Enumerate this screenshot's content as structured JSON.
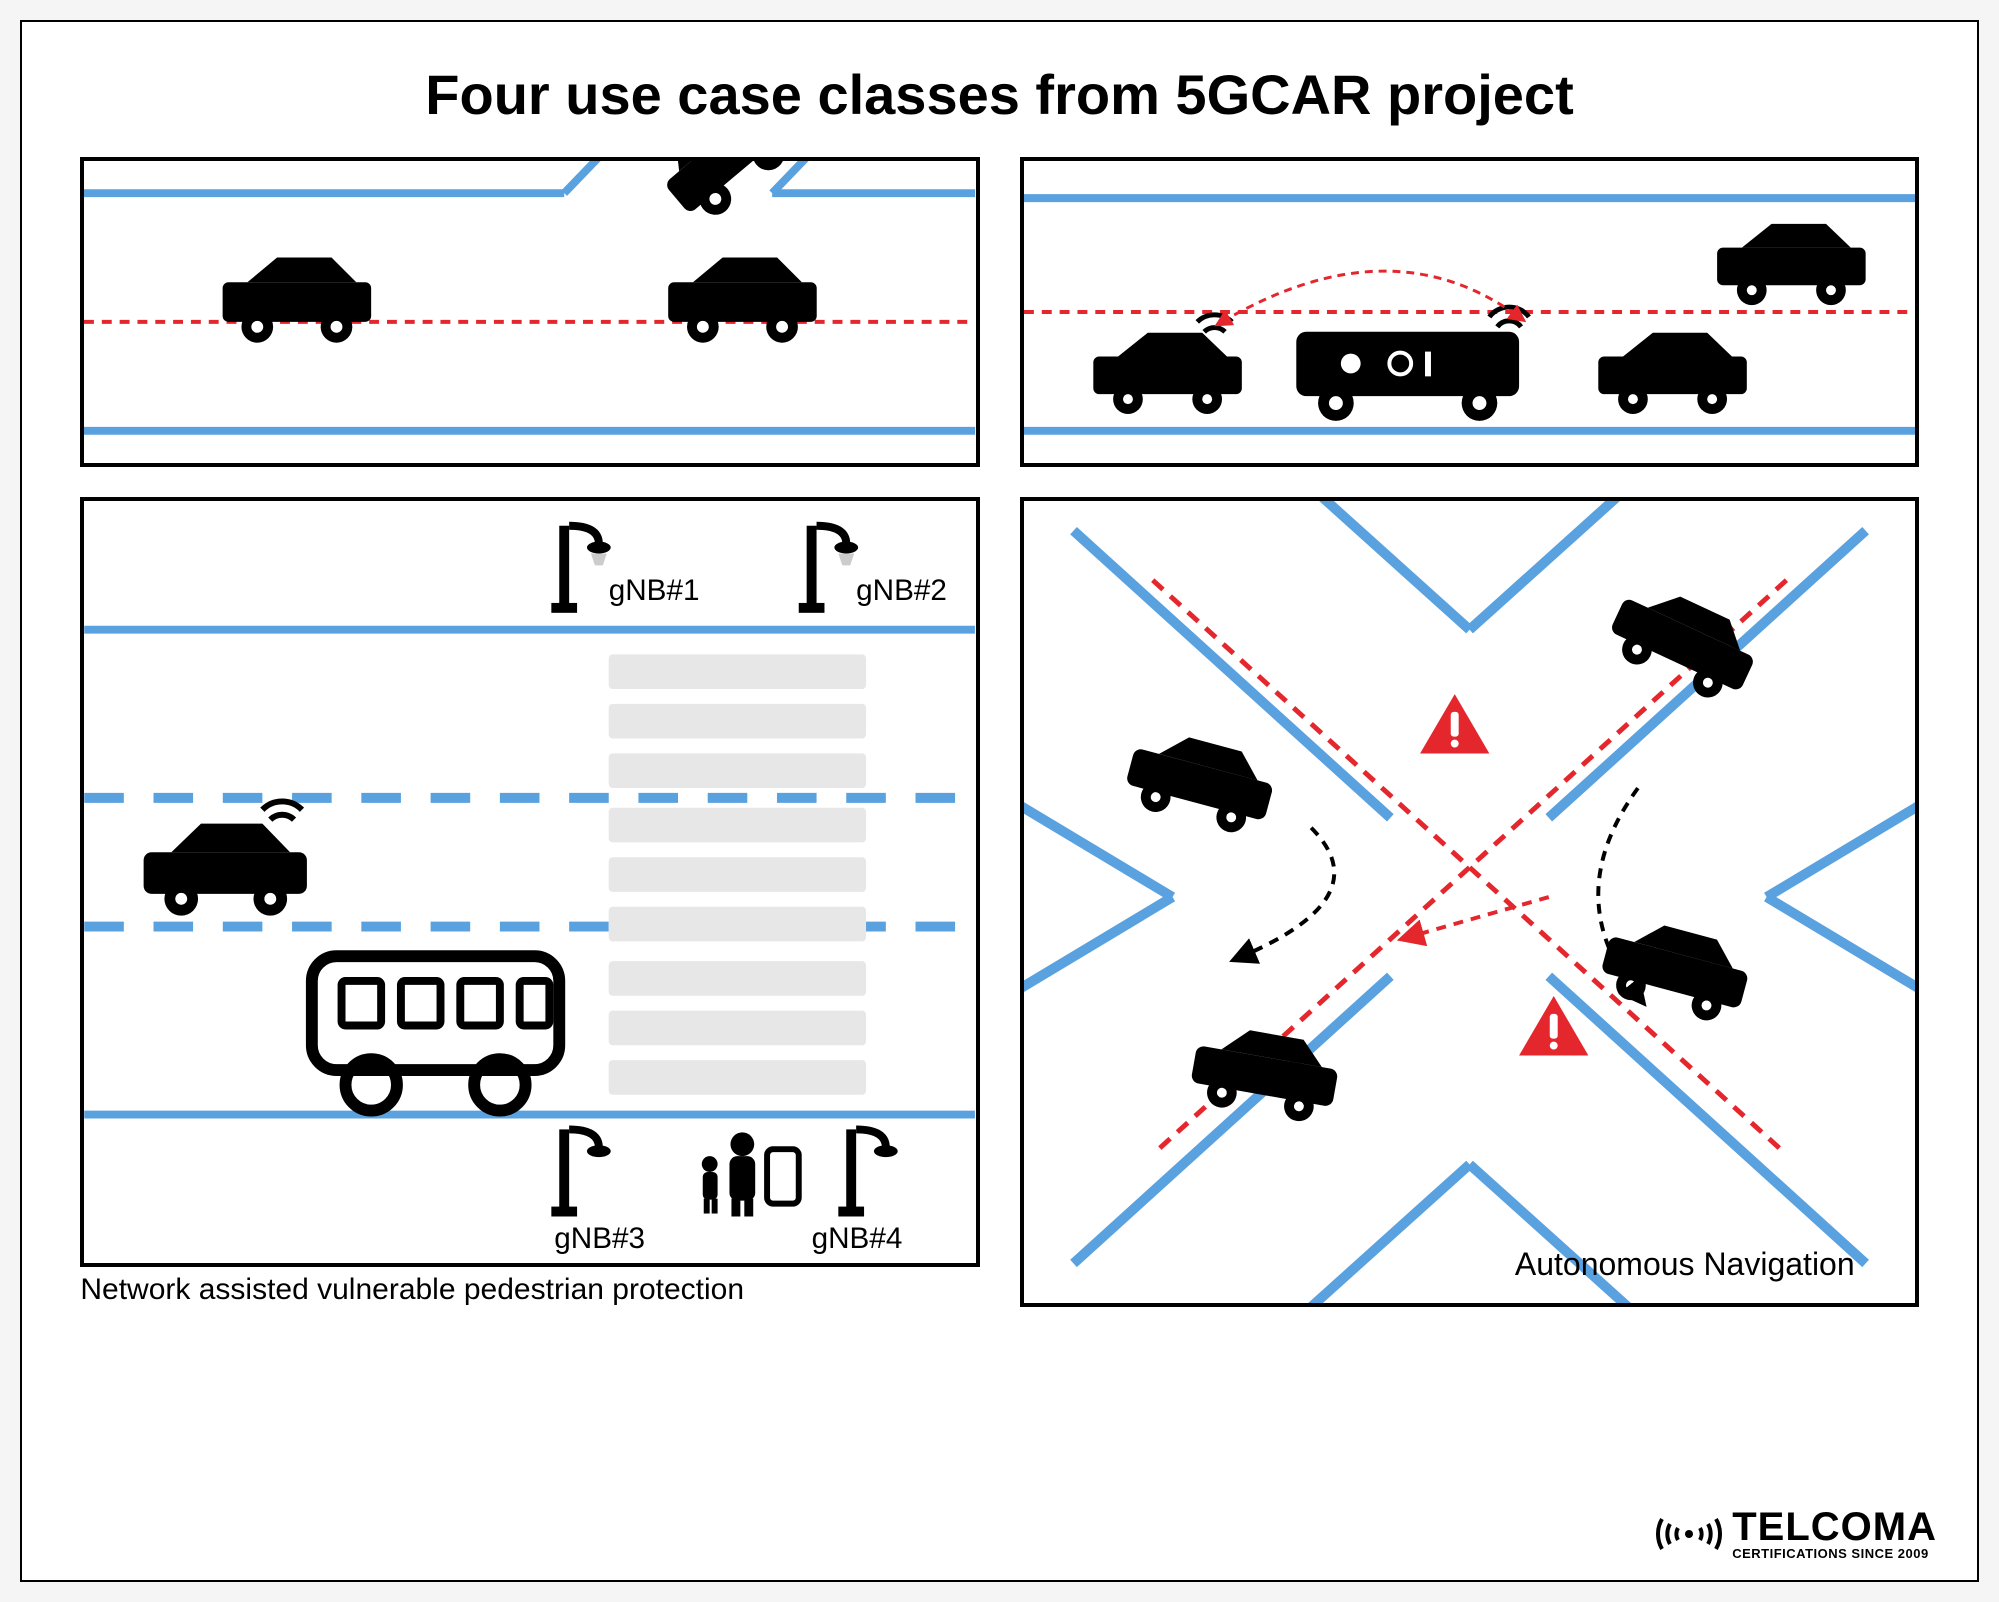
{
  "title": "Four use case classes from 5GCAR project",
  "panels": {
    "topLeft": {
      "label": ""
    },
    "topRight": {
      "label": ""
    },
    "bottomLeft": {
      "caption": "Network assisted vulnerable pedestrian protection",
      "gnb1": "gNB#1",
      "gnb2": "gNB#2",
      "gnb3": "gNB#3",
      "gnb4": "gNB#4"
    },
    "bottomRight": {
      "caption": "Autonomous Navigation"
    }
  },
  "branding": {
    "brand": "TELCOMA",
    "sub": "CERTIFICATIONS SINCE 2009"
  },
  "colors": {
    "road": "#5aa1df",
    "danger": "#e4272d",
    "mark": "#e5e5e5"
  }
}
